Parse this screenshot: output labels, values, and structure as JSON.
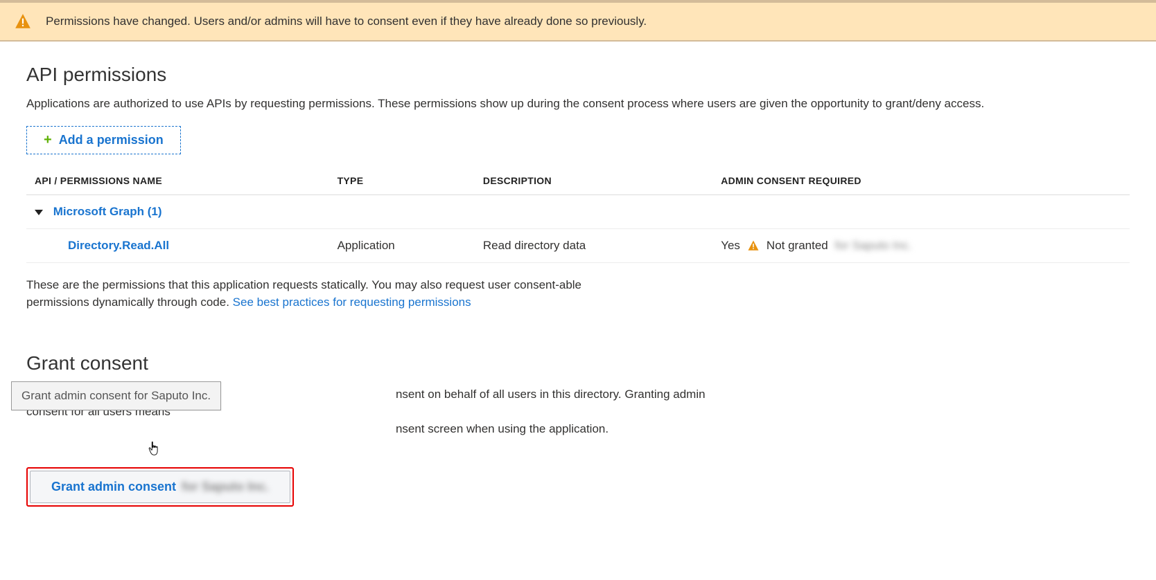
{
  "notification": {
    "text": "Permissions have changed. Users and/or admins will have to consent even if they have already done so previously."
  },
  "api_permissions": {
    "title": "API permissions",
    "description": "Applications are authorized to use APIs by requesting permissions. These permissions show up during the consent process where users are given the opportunity to grant/deny access.",
    "add_button": "Add a permission",
    "headers": {
      "name": "API / PERMISSIONS NAME",
      "type": "TYPE",
      "description": "DESCRIPTION",
      "admin_consent": "ADMIN CONSENT REQUIRED"
    },
    "group": {
      "label": "Microsoft Graph (1)"
    },
    "rows": [
      {
        "name": "Directory.Read.All",
        "type": "Application",
        "description": "Read directory data",
        "admin_required": "Yes",
        "status": "Not granted",
        "status_suffix": "for Saputo Inc."
      }
    ],
    "footnote_text": "These are the permissions that this application requests statically. You may also request user consent-able permissions dynamically through code. ",
    "footnote_link": "See best practices for requesting permissions"
  },
  "grant_consent": {
    "title": "Grant consent",
    "tooltip": "Grant admin consent for Saputo Inc.",
    "description_tail": "nsent on behalf of all users in this directory. Granting admin consent for all users means",
    "description_line2_tail": "nsent screen when using the application.",
    "button_label": "Grant admin consent",
    "button_suffix": "for Saputo Inc."
  }
}
